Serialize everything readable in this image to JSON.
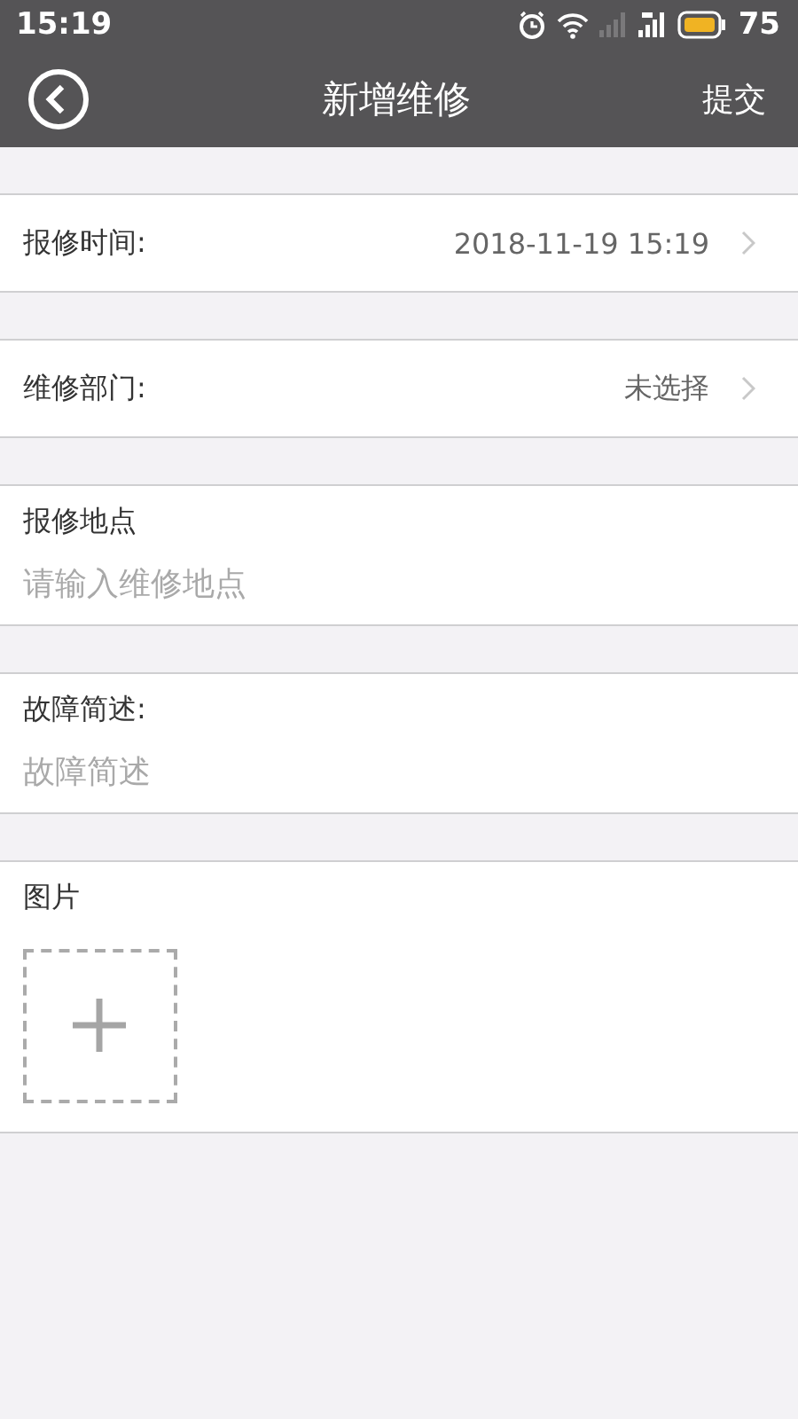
{
  "status_bar": {
    "time": "15:19",
    "battery": "75"
  },
  "header": {
    "title": "新增维修",
    "action": "提交"
  },
  "sections": [
    {
      "kind": "select",
      "label": "报修时间:",
      "value": "2018-11-19 15:19"
    },
    {
      "kind": "select",
      "label": "维修部门:",
      "value": "未选择"
    },
    {
      "kind": "input",
      "label": "报修地点",
      "placeholder": "请输入维修地点"
    },
    {
      "kind": "input",
      "label": "故障简述:",
      "placeholder": "故障简述"
    },
    {
      "kind": "photos",
      "label": "图片"
    }
  ]
}
